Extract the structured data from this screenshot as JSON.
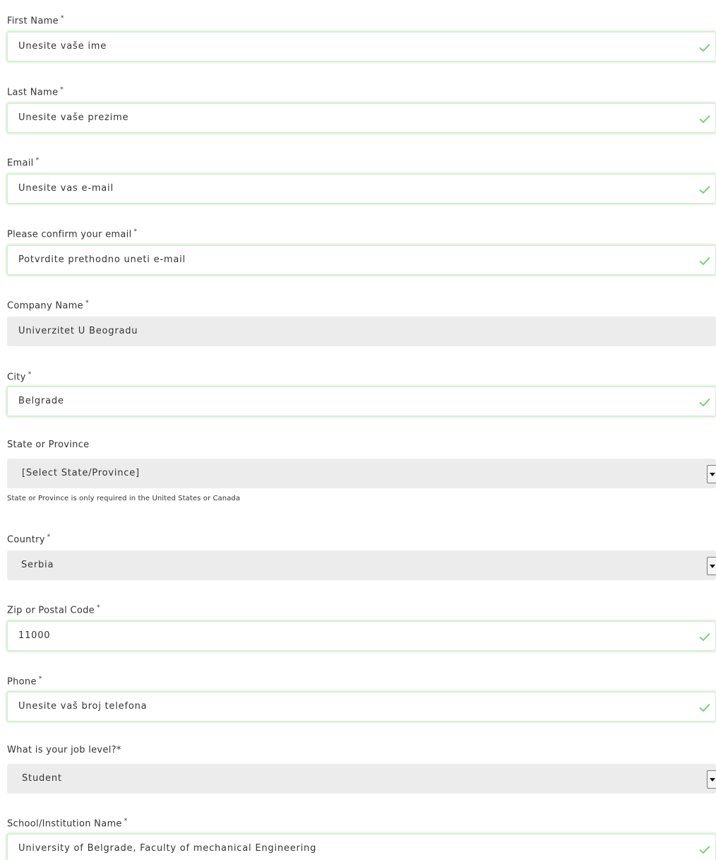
{
  "form": {
    "required_marker": "*",
    "fields": {
      "first_name": {
        "label": "First Name",
        "value": "Unesite vaše ime"
      },
      "last_name": {
        "label": "Last Name",
        "value": "Unesite vaše prezime"
      },
      "email": {
        "label": "Email",
        "value": "Unesite vas e-mail"
      },
      "confirm_email": {
        "label": "Please confirm your email",
        "value": "Potvrdite prethodno uneti e-mail"
      },
      "company": {
        "label": "Company Name",
        "value": "Univerzitet U Beogradu"
      },
      "city": {
        "label": "City",
        "value": "Belgrade"
      },
      "state": {
        "label": "State or Province",
        "value": "[Select State/Province]",
        "hint": "State or Province is only required in the United States or Canada"
      },
      "country": {
        "label": "Country",
        "value": "Serbia"
      },
      "zip": {
        "label": "Zip or Postal Code",
        "value": "11000"
      },
      "phone": {
        "label": "Phone",
        "value": "Unesite vaš broj telefona"
      },
      "job_level": {
        "label": "What is your job level?*",
        "value": "Student"
      },
      "school": {
        "label": "School/Institution Name",
        "value": "University of Belgrade, Faculty of mechanical Engineering"
      }
    },
    "icons": {
      "valid": "checkmark-icon",
      "dropdown": "dropdown-arrow-icon"
    },
    "colors": {
      "valid_check": "#7ed07a",
      "valid_glow": "#9fd89a",
      "disabled_bg": "#ececec",
      "text": "#333333"
    }
  }
}
